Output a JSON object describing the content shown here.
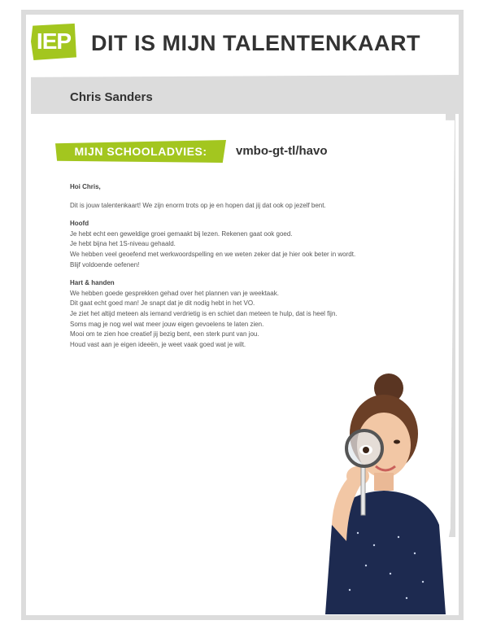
{
  "header": {
    "logo_text": "IEP",
    "title": "DIT IS MIJN TALENTENKAART"
  },
  "student": {
    "name": "Chris Sanders"
  },
  "advice": {
    "label": "MIJN SCHOOLADVIES:",
    "value": "vmbo-gt-tl/havo"
  },
  "letter": {
    "greeting": "Hoi Chris,",
    "intro": "Dit is jouw talentenkaart! We zijn enorm trots op je en hopen dat jij dat ook op jezelf bent.",
    "sections": [
      {
        "heading": "Hoofd",
        "lines": [
          "Je hebt echt een geweldige groei gemaakt bij lezen. Rekenen gaat ook goed.",
          "Je hebt bijna het 1S-niveau gehaald.",
          "We hebben veel geoefend met werkwoordspelling en we weten zeker dat je hier ook beter in wordt.",
          "Blijf voldoende oefenen!"
        ]
      },
      {
        "heading": "Hart & handen",
        "lines": [
          "We hebben goede gesprekken gehad over het plannen van je weektaak.",
          "Dit gaat echt goed man! Je snapt dat je dit nodig hebt in het VO.",
          "Je ziet het altijd meteen als iemand verdrietig is en schiet dan meteen te hulp, dat is heel fijn.",
          "Soms mag je nog wel wat meer jouw eigen gevoelens te laten zien.",
          "Mooi om te zien hoe creatief jij bezig bent, een sterk punt van jou.",
          "Houd vast aan je eigen ideeën, je weet vaak goed wat je wilt."
        ]
      }
    ]
  },
  "colors": {
    "accent": "#a3c61f",
    "frame": "#dcdcdc",
    "text": "#333333"
  }
}
